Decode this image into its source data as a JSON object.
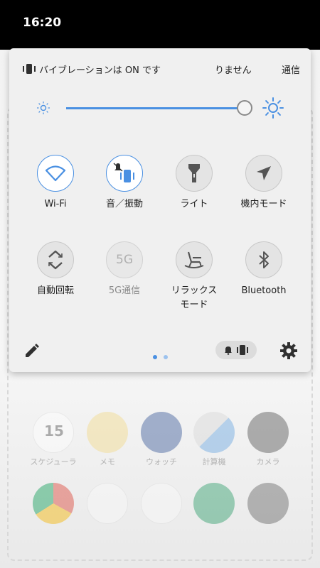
{
  "status_bar": {
    "time": "16:20"
  },
  "notification": {
    "icon": "vibrate-icon",
    "text1": "バイブレーションは ON です",
    "text2": "りません",
    "text3": "通信"
  },
  "brightness": {
    "level": 0.93,
    "icon_low": "sun-small-icon",
    "icon_high": "sun-large-icon"
  },
  "tiles": [
    {
      "label": "Wi-Fi",
      "icon": "wifi-icon",
      "state": "on"
    },
    {
      "label": "音／振動",
      "icon": "sound-vibrate-icon",
      "state": "on"
    },
    {
      "label": "ライト",
      "icon": "flashlight-icon",
      "state": "off"
    },
    {
      "label": "機内モード",
      "icon": "airplane-icon",
      "state": "off"
    },
    {
      "label": "自動回転",
      "icon": "auto-rotate-icon",
      "state": "off"
    },
    {
      "label": "5G通信",
      "icon": "5g-icon",
      "state": "disabled",
      "icon_text": "5G"
    },
    {
      "label": "リラックス\nモード",
      "icon": "rocking-chair-icon",
      "state": "off"
    },
    {
      "label": "Bluetooth",
      "icon": "bluetooth-icon",
      "state": "off"
    }
  ],
  "pager": {
    "current": 1,
    "total": 2
  },
  "home_apps": [
    {
      "label": "スケジューラ",
      "icon": "calendar-icon",
      "text": "15"
    },
    {
      "label": "メモ",
      "icon": "memo-icon"
    },
    {
      "label": "ウォッチ",
      "icon": "clock-icon"
    },
    {
      "label": "計算機",
      "icon": "calculator-icon"
    },
    {
      "label": "カメラ",
      "icon": "camera-icon"
    }
  ],
  "dock_apps": [
    {
      "icon": "chrome-icon"
    },
    {
      "icon": "play-store-icon"
    },
    {
      "icon": "google-apps-icon"
    },
    {
      "icon": "phone-icon"
    },
    {
      "icon": "settings-app-icon"
    }
  ],
  "colors": {
    "accent": "#4a90e2",
    "panel_bg": "#f0f0f0",
    "tile_off_bg": "#e4e4e4",
    "icon_dark": "#555555",
    "status_bar_bg": "#000000"
  }
}
